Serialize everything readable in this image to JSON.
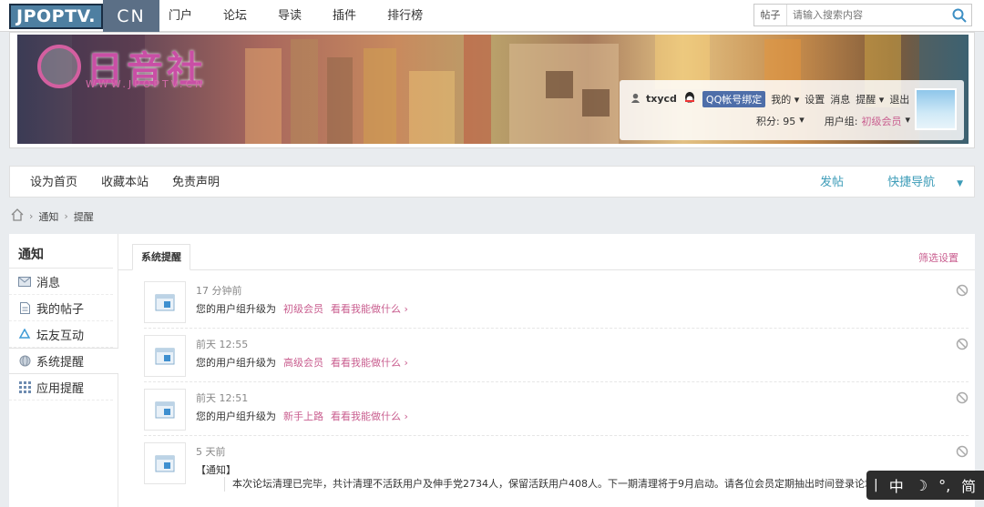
{
  "topnav": {
    "logo_main": "JPOPTV.",
    "logo_sub": "CN",
    "items": [
      "门户",
      "论坛",
      "导读",
      "插件",
      "排行榜"
    ],
    "search_type": "帖子",
    "search_placeholder": "请输入搜索内容"
  },
  "banner": {
    "logo_text": "日音社",
    "logo_sub": "WWW.JPOPTV.CN"
  },
  "user": {
    "name": "txycd",
    "qq_bind": "QQ帐号绑定",
    "links": [
      "我的",
      "设置",
      "消息",
      "提醒",
      "退出"
    ],
    "points_label": "积分: 95",
    "group_label": "用户组:",
    "group_value": "初级会员"
  },
  "subnav": {
    "left": [
      "设为首页",
      "收藏本站",
      "免责声明"
    ],
    "post": "发帖",
    "quicknav": "快捷导航"
  },
  "breadcrumb": [
    "通知",
    "提醒"
  ],
  "sidebar": {
    "title": "通知",
    "items": [
      {
        "label": "消息",
        "icon": "envelope-icon"
      },
      {
        "label": "我的帖子",
        "icon": "document-icon"
      },
      {
        "label": "坛友互动",
        "icon": "recycle-icon"
      },
      {
        "label": "系统提醒",
        "icon": "globe-icon"
      },
      {
        "label": "应用提醒",
        "icon": "grid-icon"
      }
    ]
  },
  "content": {
    "tab": "系统提醒",
    "filter": "筛选设置",
    "notifications": [
      {
        "time": "17 分钟前",
        "prefix": "您的用户组升级为",
        "group": "初级会员",
        "action": "看看我能做什么 ›"
      },
      {
        "time": "前天 12:55",
        "prefix": "您的用户组升级为",
        "group": "高级会员",
        "action": "看看我能做什么 ›"
      },
      {
        "time": "前天 12:51",
        "prefix": "您的用户组升级为",
        "group": "新手上路",
        "action": "看看我能做什么 ›"
      },
      {
        "time": "5 天前",
        "title": "【通知】",
        "body": "本次论坛清理已完毕，共计清理不活跃用户及伸手党2734人，保留活跃用户408人。下一期清理将于9月启动。请各位会员定期抽出时间登录论坛并发帖。"
      }
    ]
  },
  "ime": {
    "label_zh": "中",
    "label_jian": "简",
    "moon": "☽",
    "dot": "°,"
  },
  "colors": {
    "accent_pink": "#c95e8f",
    "accent_teal": "#3d9cb8",
    "logo_blue": "#4e7fa1"
  }
}
